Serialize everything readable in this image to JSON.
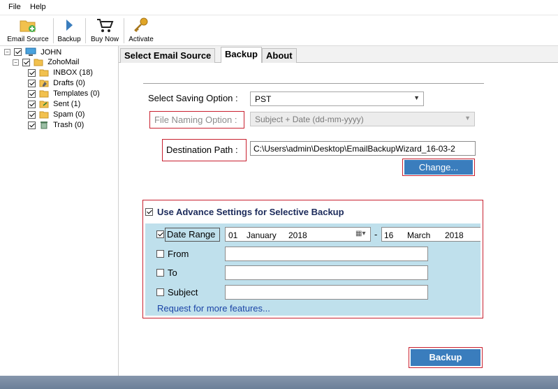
{
  "menu": [
    "File",
    "Help"
  ],
  "toolbar": {
    "email_source": "Email Source",
    "backup": "Backup",
    "buy_now": "Buy Now",
    "activate": "Activate"
  },
  "tree": {
    "root": "JOHN",
    "account": "ZohoMail",
    "folders": [
      {
        "label": "INBOX (18)",
        "icon": "inbox-icon"
      },
      {
        "label": "Drafts (0)",
        "icon": "drafts-icon"
      },
      {
        "label": "Templates (0)",
        "icon": "folder-icon"
      },
      {
        "label": "Sent (1)",
        "icon": "sent-icon"
      },
      {
        "label": "Spam (0)",
        "icon": "folder-icon"
      },
      {
        "label": "Trash (0)",
        "icon": "trash-icon"
      }
    ]
  },
  "tabs": [
    "Select Email Source",
    "Backup",
    "About"
  ],
  "active_tab": "Backup",
  "form": {
    "saving_option_label": "Select Saving Option :",
    "saving_option_value": "PST",
    "file_naming_label": "File Naming Option :",
    "file_naming_value": "Subject + Date (dd-mm-yyyy)",
    "destination_label": "Destination Path :",
    "destination_value": "C:\\Users\\admin\\Desktop\\EmailBackupWizard_16-03-2",
    "change_button": "Change..."
  },
  "advanced": {
    "title": "Use Advance Settings for Selective Backup",
    "date_range_label": "Date Range",
    "date_from": {
      "day": "01",
      "month": "January",
      "year": "2018"
    },
    "dash": "-",
    "date_to": {
      "day": "16",
      "month": "March",
      "year": "2018"
    },
    "from_label": "From",
    "to_label": "To",
    "subject_label": "Subject",
    "request_link": "Request for more features..."
  },
  "backup_button": "Backup",
  "colors": {
    "accent_blue": "#3a7dbd",
    "highlight_red": "#c8202f",
    "panel_blue": "#bfe0ec",
    "link_blue": "#1a44a6"
  }
}
